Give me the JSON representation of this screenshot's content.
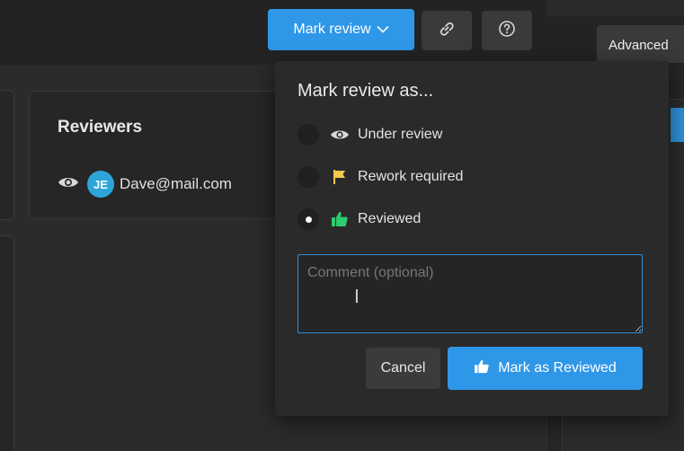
{
  "toolbar": {
    "mark_review_label": "Mark review",
    "link_icon": "link-icon",
    "help_icon": "help-icon",
    "advanced_label": "Advanced"
  },
  "reviewers": {
    "title": "Reviewers",
    "items": [
      {
        "initials": "JE",
        "email": "Dave@mail.com",
        "avatar_color": "#2da5d9"
      }
    ]
  },
  "popover": {
    "title": "Mark review as...",
    "options": [
      {
        "label": "Under review",
        "icon": "eye-icon",
        "selected": false
      },
      {
        "label": "Rework required",
        "icon": "flag-icon",
        "icon_color": "#f2c94c",
        "selected": false
      },
      {
        "label": "Reviewed",
        "icon": "thumbs-up-icon",
        "icon_color": "#2ecc71",
        "selected": true
      }
    ],
    "comment_placeholder": "Comment (optional)",
    "comment_value": "",
    "cancel_label": "Cancel",
    "submit_label": "Mark as Reviewed"
  },
  "colors": {
    "accent": "#2f97e8",
    "background": "#2b2b2b",
    "popover": "#2a2a2a",
    "success": "#2ecc71",
    "warning": "#f2c94c"
  }
}
